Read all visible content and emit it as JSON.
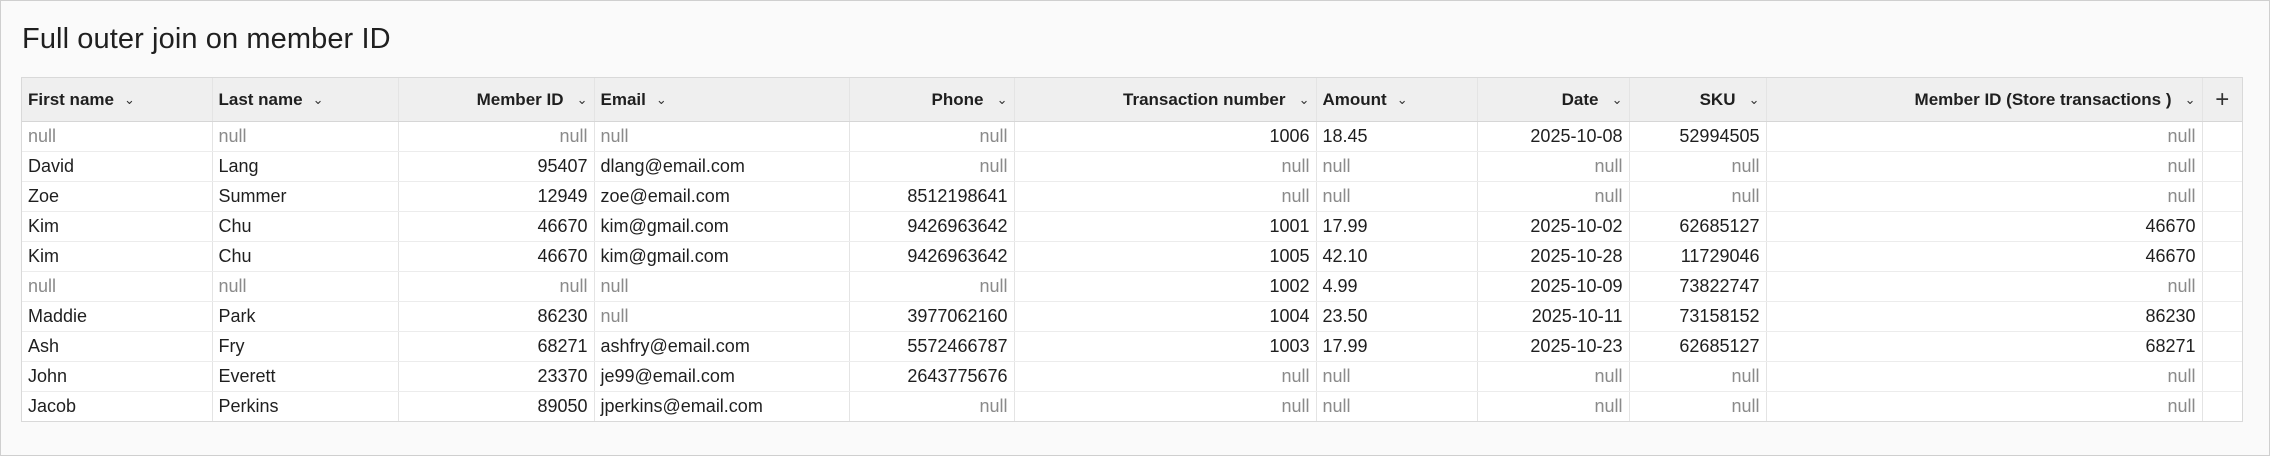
{
  "page": {
    "title": "Full outer join on member ID"
  },
  "table": {
    "add_column_label": "+",
    "chevron": "⌄",
    "columns": [
      {
        "key": "first",
        "label": "First name",
        "align": "left"
      },
      {
        "key": "last",
        "label": "Last name",
        "align": "left"
      },
      {
        "key": "member",
        "label": "Member ID",
        "align": "right"
      },
      {
        "key": "email",
        "label": "Email",
        "align": "left"
      },
      {
        "key": "phone",
        "label": "Phone",
        "align": "right"
      },
      {
        "key": "txn",
        "label": "Transaction number",
        "align": "right"
      },
      {
        "key": "amount",
        "label": "Amount",
        "align": "left"
      },
      {
        "key": "date",
        "label": "Date",
        "align": "right"
      },
      {
        "key": "sku",
        "label": "SKU",
        "align": "right"
      },
      {
        "key": "member_st",
        "label": "Member ID (Store transactions )",
        "align": "right"
      }
    ],
    "rows": [
      [
        "null",
        "null",
        "null",
        "null",
        "null",
        "1006",
        "18.45",
        "2025-10-08",
        "52994505",
        "null"
      ],
      [
        "David",
        "Lang",
        "95407",
        "dlang@email.com",
        "null",
        "null",
        "null",
        "null",
        "null",
        "null"
      ],
      [
        "Zoe",
        "Summer",
        "12949",
        "zoe@email.com",
        "8512198641",
        "null",
        "null",
        "null",
        "null",
        "null"
      ],
      [
        "Kim",
        "Chu",
        "46670",
        "kim@gmail.com",
        "9426963642",
        "1001",
        "17.99",
        "2025-10-02",
        "62685127",
        "46670"
      ],
      [
        "Kim",
        "Chu",
        "46670",
        "kim@gmail.com",
        "9426963642",
        "1005",
        "42.10",
        "2025-10-28",
        "11729046",
        "46670"
      ],
      [
        "null",
        "null",
        "null",
        "null",
        "null",
        "1002",
        "4.99",
        "2025-10-09",
        "73822747",
        "null"
      ],
      [
        "Maddie",
        "Park",
        "86230",
        "null",
        "3977062160",
        "1004",
        "23.50",
        "2025-10-11",
        "73158152",
        "86230"
      ],
      [
        "Ash",
        "Fry",
        "68271",
        "ashfry@email.com",
        "5572466787",
        "1003",
        "17.99",
        "2025-10-23",
        "62685127",
        "68271"
      ],
      [
        "John",
        "Everett",
        "23370",
        "je99@email.com",
        "2643775676",
        "null",
        "null",
        "null",
        "null",
        "null"
      ],
      [
        "Jacob",
        "Perkins",
        "89050",
        "jperkins@email.com",
        "null",
        "null",
        "null",
        "null",
        "null",
        "null"
      ]
    ],
    "colors": {
      "null_text": "#8a8a8a",
      "header_bg": "#efefef"
    }
  }
}
